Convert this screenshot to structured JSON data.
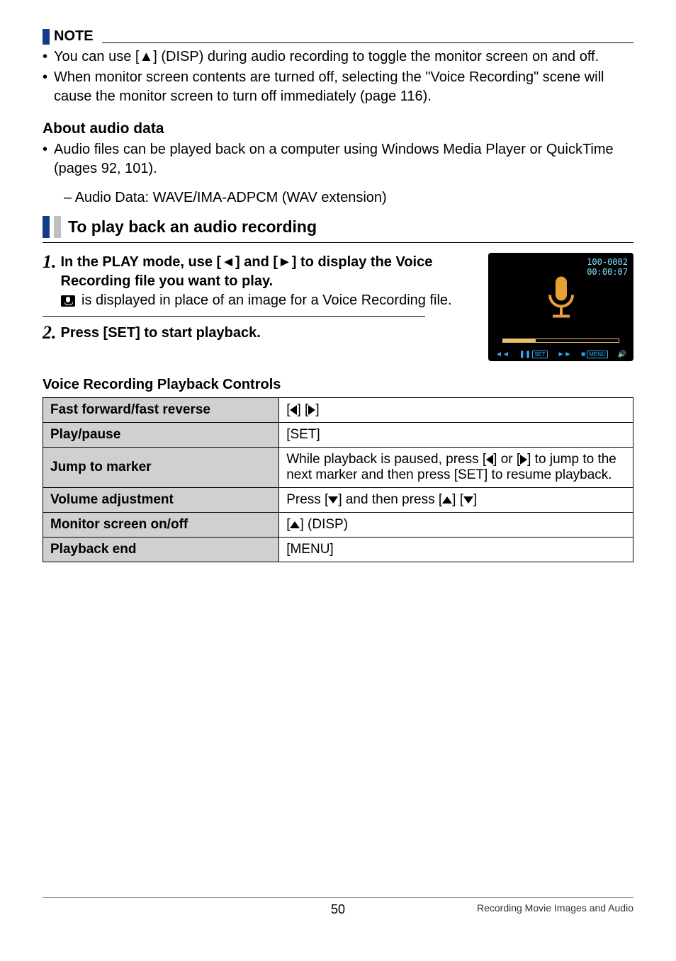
{
  "note": {
    "label": "NOTE",
    "items": [
      "You can use [▲] (DISP) during audio recording to toggle the monitor screen on and off.",
      "When monitor screen contents are turned off, selecting the \"Voice Recording\" scene will cause the monitor screen to turn off immediately (page 116)."
    ]
  },
  "audio_data": {
    "heading": "About audio data",
    "bullet": "Audio files can be played back on a computer using Windows Media Player or QuickTime (pages 92, 101).",
    "sub": "– Audio Data: WAVE/IMA-ADPCM (WAV extension)"
  },
  "procedure": {
    "title": "To play back an audio recording",
    "step1_title": "In the PLAY mode, use [◄] and [►] to display the Voice Recording file you want to play.",
    "step1_desc": " is displayed in place of an image for a Voice Recording file.",
    "step2_title": "Press [SET] to start playback."
  },
  "thumb": {
    "line1": "100-0002",
    "line2": "00:00:07",
    "ctrl_set": "SET",
    "ctrl_menu": "MENU"
  },
  "controls": {
    "heading": "Voice Recording Playback Controls",
    "rows": [
      {
        "label": "Fast forward/fast reverse",
        "value_html": "[◄] [►]"
      },
      {
        "label": "Play/pause",
        "value_html": "[SET]"
      },
      {
        "label": "Jump to marker",
        "value_html": "While playback is paused, press [◄] or [►] to jump to the next marker and then press [SET] to resume playback."
      },
      {
        "label": "Volume adjustment",
        "value_html": "Press [▼] and then press [▲] [▼]"
      },
      {
        "label": "Monitor screen on/off",
        "value_html": "[▲] (DISP)"
      },
      {
        "label": "Playback end",
        "value_html": "[MENU]"
      }
    ]
  },
  "footer": {
    "page": "50",
    "section": "Recording Movie Images and Audio"
  }
}
